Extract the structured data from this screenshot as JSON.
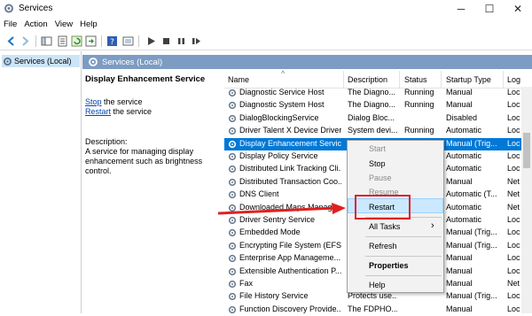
{
  "window": {
    "title": "Services",
    "minimize": "─",
    "maximize": "☐",
    "close": "✕"
  },
  "menu": [
    "File",
    "Action",
    "View",
    "Help"
  ],
  "tree": {
    "item": "Services (Local)"
  },
  "main_header": "Services (Local)",
  "detail": {
    "service_name": "Display Enhancement Service",
    "stop_link": "Stop",
    "stop_rest": " the service",
    "restart_link": "Restart",
    "restart_rest": " the service",
    "desc_label": "Description:",
    "desc_lines": [
      "A service for managing display",
      "enhancement such as brightness",
      "control."
    ]
  },
  "columns": [
    "Name",
    "Description",
    "Status",
    "Startup Type",
    "Log"
  ],
  "rows": [
    {
      "name": "Diagnostic Service Host",
      "desc": "The Diagno...",
      "status": "Running",
      "startup": "Manual",
      "log": "Loc"
    },
    {
      "name": "Diagnostic System Host",
      "desc": "The Diagno...",
      "status": "Running",
      "startup": "Manual",
      "log": "Loc"
    },
    {
      "name": "DialogBlockingService",
      "desc": "Dialog Bloc...",
      "status": "",
      "startup": "Disabled",
      "log": "Loc"
    },
    {
      "name": "Driver Talent X Device Driver...",
      "desc": "System devi...",
      "status": "Running",
      "startup": "Automatic",
      "log": "Loc"
    },
    {
      "name": "Display Enhancement Service",
      "desc": "",
      "status": "",
      "startup": "Manual (Trig...",
      "log": "Loc"
    },
    {
      "name": "Display Policy Service",
      "desc": "",
      "status": "",
      "startup": "Automatic",
      "log": "Loc"
    },
    {
      "name": "Distributed Link Tracking Cli...",
      "desc": "",
      "status": "",
      "startup": "Automatic",
      "log": "Loc"
    },
    {
      "name": "Distributed Transaction Coo...",
      "desc": "",
      "status": "",
      "startup": "Manual",
      "log": "Net"
    },
    {
      "name": "DNS Client",
      "desc": "",
      "status": "",
      "startup": "Automatic (T...",
      "log": "Net"
    },
    {
      "name": "Downloaded Maps Manager",
      "desc": "",
      "status": "",
      "startup": "Automatic",
      "log": "Net"
    },
    {
      "name": "Driver Sentry Service",
      "desc": "",
      "status": "",
      "startup": "Automatic",
      "log": "Loc"
    },
    {
      "name": "Embedded Mode",
      "desc": "",
      "status": "",
      "startup": "Manual (Trig...",
      "log": "Loc"
    },
    {
      "name": "Encrypting File System (EFS)",
      "desc": "",
      "status": "",
      "startup": "Manual (Trig...",
      "log": "Loc"
    },
    {
      "name": "Enterprise App Manageme...",
      "desc": "",
      "status": "",
      "startup": "Manual",
      "log": "Loc"
    },
    {
      "name": "Extensible Authentication P...",
      "desc": "",
      "status": "",
      "startup": "Manual",
      "log": "Loc"
    },
    {
      "name": "Fax",
      "desc": "",
      "status": "",
      "startup": "Manual",
      "log": "Net"
    },
    {
      "name": "File History Service",
      "desc": "Protects use...",
      "status": "",
      "startup": "Manual (Trig...",
      "log": "Loc"
    },
    {
      "name": "Function Discovery Provide...",
      "desc": "The FDPHO...",
      "status": "",
      "startup": "Manual",
      "log": "Loc"
    }
  ],
  "context_menu": {
    "start": "Start",
    "stop": "Stop",
    "pause": "Pause",
    "resume": "Resume",
    "restart": "Restart",
    "all_tasks": "All Tasks",
    "all_tasks_arrow": "›",
    "refresh": "Refresh",
    "properties": "Properties",
    "help": "Help"
  },
  "colors": {
    "header_blue": "#7c9cc3",
    "selection": "#0078d7",
    "annotation_red": "#e02020"
  }
}
